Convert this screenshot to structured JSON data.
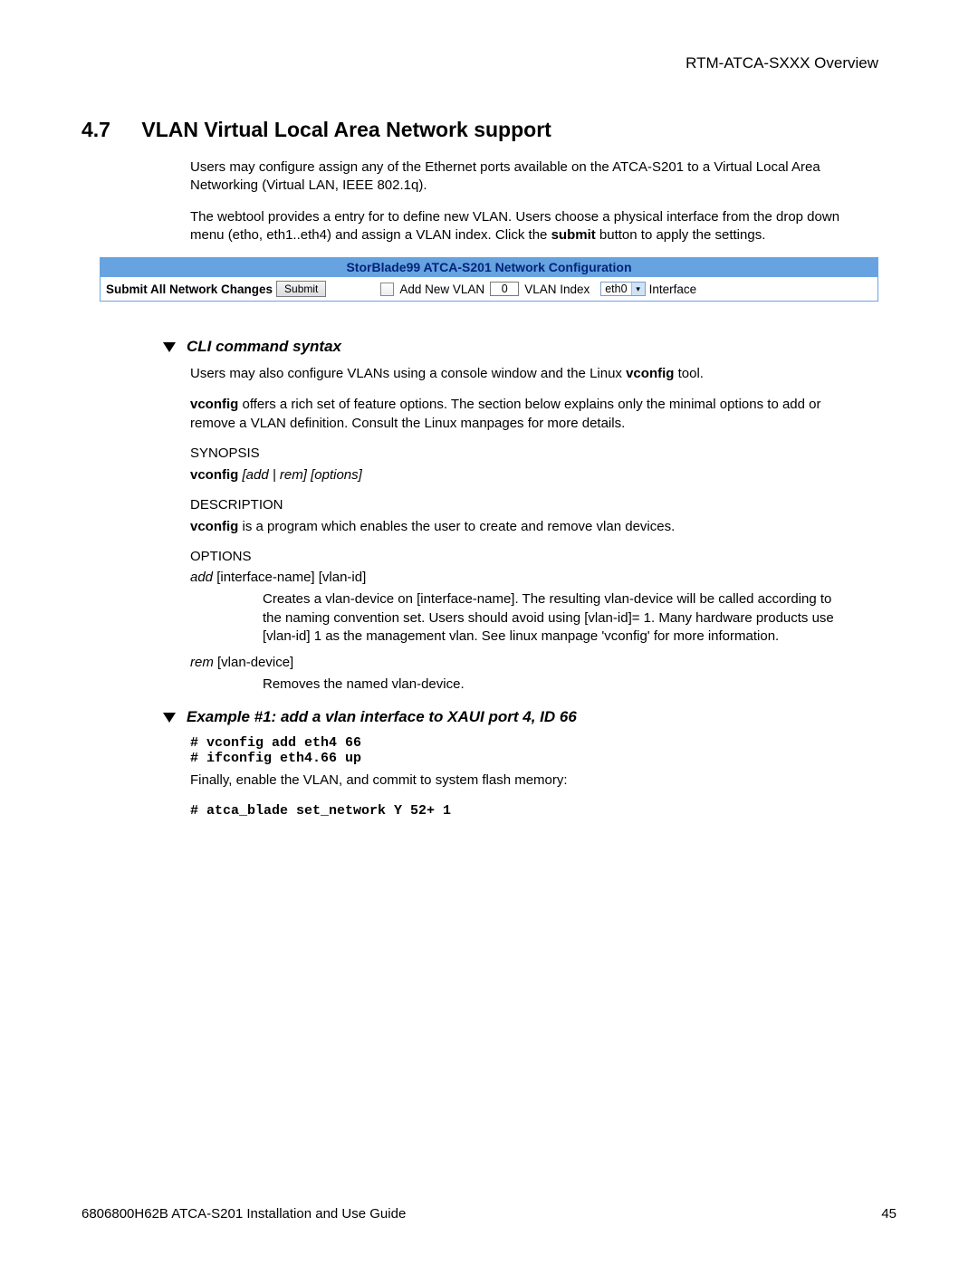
{
  "header": {
    "title": "RTM-ATCA-SXXX Overview"
  },
  "section": {
    "num": "4.7",
    "title": "VLAN Virtual Local Area Network support",
    "p1": "Users may configure assign any of the Ethernet ports available on the ATCA-S201 to a Virtual Local Area Networking (Virtual LAN, IEEE 802.1q).",
    "p2a": "The webtool provides a entry for to define new VLAN.  Users choose a physical interface from the drop down menu (etho, eth1..eth4) and assign a VLAN index. Click the ",
    "p2b": "submit",
    "p2c": " button to apply the settings."
  },
  "tool": {
    "title": "StorBlade99 ATCA-S201 Network Configuration",
    "submit_label": "Submit All Network Changes",
    "submit_btn": "Submit",
    "addnew": "Add New VLAN",
    "vlan_index_value": "0",
    "vlan_index_label": "VLAN Index",
    "iface_value": "eth0",
    "iface_label": "Interface"
  },
  "cli": {
    "head": "CLI command syntax",
    "p1a": "Users may also configure VLANs using a console window and the Linux ",
    "p1b": "vconfig",
    "p1c": " tool.",
    "p2a": "vconfig",
    "p2b": " offers a rich set of feature options.  The section below explains only the minimal options to add or remove a VLAN definition.  Consult the Linux manpages for more details.",
    "synopsis": "SYNOPSIS",
    "syn_cmd": "vconfig",
    "syn_args": "  [add | rem] [options]",
    "description": "DESCRIPTION",
    "desc_a": "vconfig",
    "desc_b": " is a program which enables the user to create and remove vlan devices.",
    "options": "OPTIONS",
    "opt_add_a": " add",
    "opt_add_b": " [interface-name] [vlan-id]",
    "opt_add_body": "Creates a vlan-device on [interface-name]. The resulting vlan-device will be called             according to the naming convention set.  Users should avoid using [vlan-id]= 1. Many hardware products use [vlan-id] 1 as the management vlan.  See linux manpage 'vconfig' for more information.",
    "opt_rem_a": "rem",
    "opt_rem_b": " [vlan-device]",
    "opt_rem_body": "Removes the named vlan-device."
  },
  "ex": {
    "head": "Example #1: add a  vlan interface to XAUI port 4, ID 66",
    "code1": "# vconfig add eth4 66\n# ifconfig eth4.66 up",
    "p": "Finally, enable the VLAN, and commit to system flash memory:",
    "code2": "# atca_blade set_network Y 52+ 1"
  },
  "footer": {
    "left": "6806800H62B ATCA-S201 Installation and Use Guide",
    "right": "45"
  }
}
